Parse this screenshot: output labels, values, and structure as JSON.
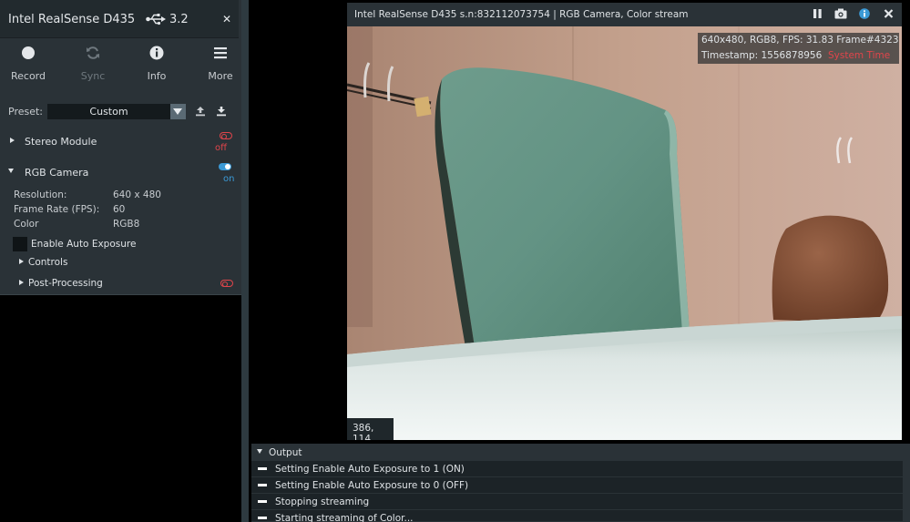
{
  "device": {
    "name": "Intel RealSense D435",
    "usb_version": "3.2"
  },
  "toolbar": {
    "record": "Record",
    "sync": "Sync",
    "info": "Info",
    "more": "More"
  },
  "preset": {
    "label": "Preset:",
    "value": "Custom"
  },
  "stereo_module": {
    "label": "Stereo Module",
    "state": "off"
  },
  "rgb_camera": {
    "label": "RGB Camera",
    "state": "on",
    "properties": [
      {
        "label": "Resolution:",
        "value": "640 x 480"
      },
      {
        "label": "Frame Rate (FPS):",
        "value": "60"
      },
      {
        "label": "Color",
        "value": "RGB8"
      }
    ],
    "auto_exposure_label": "Enable Auto Exposure",
    "controls_label": "Controls",
    "post_processing_label": "Post-Processing"
  },
  "stream": {
    "title": "Intel RealSense D435 s.n:832112073754 | RGB Camera, Color stream",
    "info_line1": "640x480, RGB8, FPS:  31.83  Frame#4323",
    "timestamp_label": "Timestamp: 1556878956",
    "system_time": "System Time",
    "cursor_readout": "386, 114"
  },
  "output": {
    "title": "Output",
    "logs": [
      "Setting Enable Auto Exposure to 1 (ON)",
      "Setting Enable Auto Exposure to 0 (OFF)",
      "Stopping streaming",
      "Starting streaming of Color..."
    ]
  },
  "colors": {
    "panel_bg": "#2a3237",
    "accent_blue": "#3b9ad6",
    "off_red": "#e0454b"
  }
}
